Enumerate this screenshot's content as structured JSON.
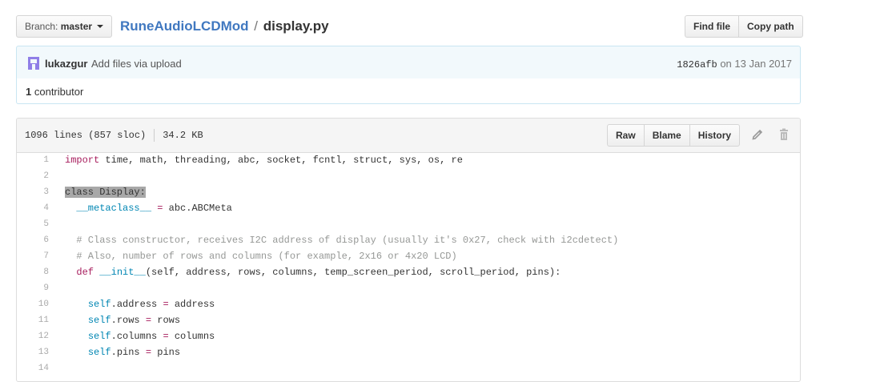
{
  "branch": {
    "label": "Branch:",
    "name": "master"
  },
  "breadcrumb": {
    "repo": "RuneAudioLCDMod",
    "separator": "/",
    "file": "display.py"
  },
  "file_nav": {
    "find_file": "Find file",
    "copy_path": "Copy path"
  },
  "commit": {
    "author": "lukazgur",
    "message": "Add files via upload",
    "sha": "1826afb",
    "date_prefix": "on",
    "date": "13 Jan 2017"
  },
  "contributors": {
    "count": "1",
    "label": "contributor"
  },
  "file": {
    "lines_info": "1096 lines (857 sloc)",
    "size": "34.2 KB",
    "raw": "Raw",
    "blame": "Blame",
    "history": "History"
  },
  "code": [
    {
      "n": "1",
      "t": [
        [
          "k",
          "import"
        ],
        [
          "",
          " time, math, threading, abc, socket, fcntl, struct, sys, os, re"
        ]
      ]
    },
    {
      "n": "2",
      "t": []
    },
    {
      "n": "3",
      "t": [
        [
          "hl",
          "class Display:"
        ]
      ]
    },
    {
      "n": "4",
      "t": [
        [
          "",
          "  "
        ],
        [
          "f",
          "__metaclass__"
        ],
        [
          "",
          " "
        ],
        [
          "o",
          "="
        ],
        [
          "",
          " abc.ABCMeta"
        ]
      ]
    },
    {
      "n": "5",
      "t": []
    },
    {
      "n": "6",
      "t": [
        [
          "",
          "  "
        ],
        [
          "c",
          "# Class constructor, receives I2C address of display (usually it's 0x27, check with i2cdetect)"
        ]
      ]
    },
    {
      "n": "7",
      "t": [
        [
          "",
          "  "
        ],
        [
          "c",
          "# Also, number of rows and columns (for example, 2x16 or 4x20 LCD)"
        ]
      ]
    },
    {
      "n": "8",
      "t": [
        [
          "",
          "  "
        ],
        [
          "k",
          "def"
        ],
        [
          "",
          " "
        ],
        [
          "f",
          "__init__"
        ],
        [
          "",
          "(self, address, rows, columns, temp_screen_period, scroll_period, pins):"
        ]
      ]
    },
    {
      "n": "9",
      "t": []
    },
    {
      "n": "10",
      "t": [
        [
          "",
          "    "
        ],
        [
          "s",
          "self"
        ],
        [
          "",
          ".address "
        ],
        [
          "o",
          "="
        ],
        [
          "",
          " address"
        ]
      ]
    },
    {
      "n": "11",
      "t": [
        [
          "",
          "    "
        ],
        [
          "s",
          "self"
        ],
        [
          "",
          ".rows "
        ],
        [
          "o",
          "="
        ],
        [
          "",
          " rows"
        ]
      ]
    },
    {
      "n": "12",
      "t": [
        [
          "",
          "    "
        ],
        [
          "s",
          "self"
        ],
        [
          "",
          ".columns "
        ],
        [
          "o",
          "="
        ],
        [
          "",
          " columns"
        ]
      ]
    },
    {
      "n": "13",
      "t": [
        [
          "",
          "    "
        ],
        [
          "s",
          "self"
        ],
        [
          "",
          ".pins "
        ],
        [
          "o",
          "="
        ],
        [
          "",
          " pins"
        ]
      ]
    },
    {
      "n": "14",
      "t": []
    }
  ]
}
